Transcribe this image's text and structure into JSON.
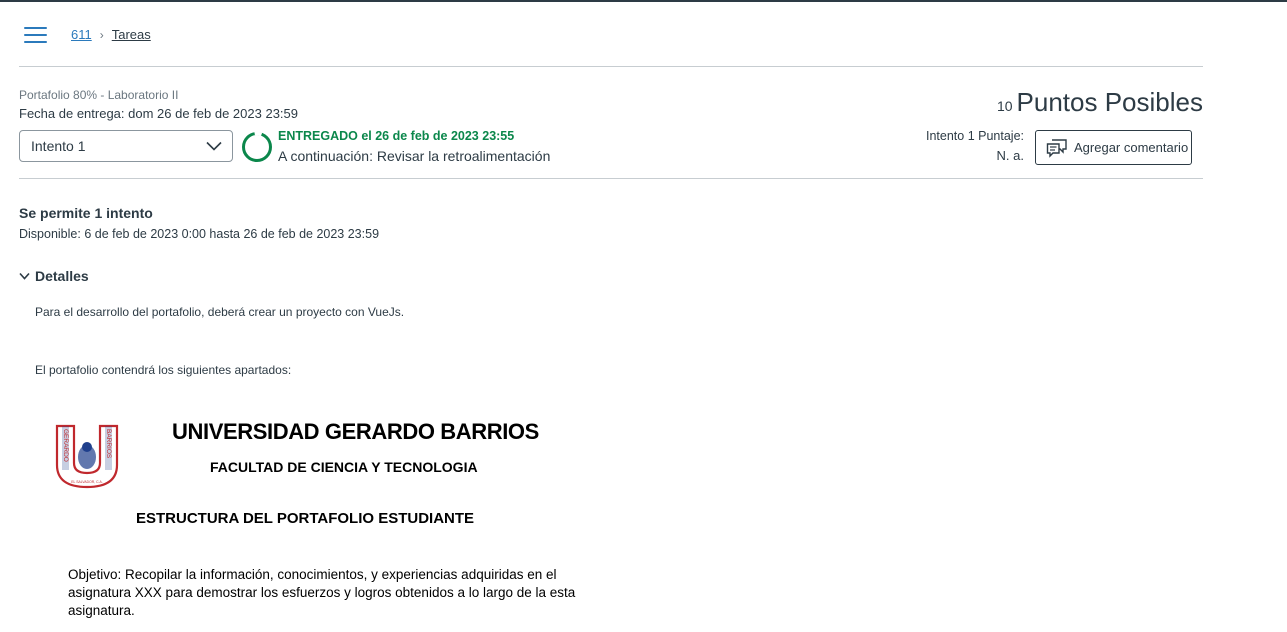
{
  "breadcrumb": {
    "course": "611",
    "page": "Tareas"
  },
  "assignment": {
    "subtitle": "Portafolio 80% - Laboratorio II",
    "due": "Fecha de entrega: dom 26 de feb de 2023 23:59",
    "attempt_selected": "Intento 1",
    "status_submitted": "ENTREGADO el 26 de feb de 2023 23:55",
    "status_next": "A continuación: Revisar la retroalimentación",
    "points_number": "10",
    "points_label": "Puntos Posibles",
    "score_label": "Intento 1 Puntaje:",
    "score_value": "N. a.",
    "comment_button": "Agregar comentario"
  },
  "info": {
    "allowed": "Se permite 1 intento",
    "available": "Disponible: 6 de feb de 2023 0:00 hasta 26 de feb de 2023 23:59"
  },
  "details": {
    "toggle_label": "Detalles",
    "paragraph1": "Para el desarrollo del portafolio, deberá crear un proyecto con VueJs.",
    "paragraph2": "El portafolio contendrá los siguientes apartados:"
  },
  "document": {
    "university": "UNIVERSIDAD GERARDO BARRIOS",
    "faculty": "FACULTAD DE CIENCIA Y TECNOLOGIA",
    "structure": "ESTRUCTURA DEL PORTAFOLIO ESTUDIANTE",
    "objective": "Objetivo: Recopilar la información, conocimientos, y experiencias adquiridas en el asignatura XXX para demostrar los esfuerzos y logros obtenidos a lo largo de la esta asignatura.",
    "logo_text_left": "GERARDO",
    "logo_text_right": "BARRIOS",
    "logo_text_bottom": "EL SALVADOR, C.A."
  },
  "colors": {
    "accent": "#2b7abc",
    "success": "#0b874b",
    "text": "#2d3b45",
    "logo_red": "#c0282d",
    "logo_blue": "#1f3f8c"
  },
  "icons": {
    "menu": "hamburger-icon",
    "chevron": "chevron-down-icon",
    "comment": "comment-icon",
    "progress": "progress-ring-icon"
  }
}
